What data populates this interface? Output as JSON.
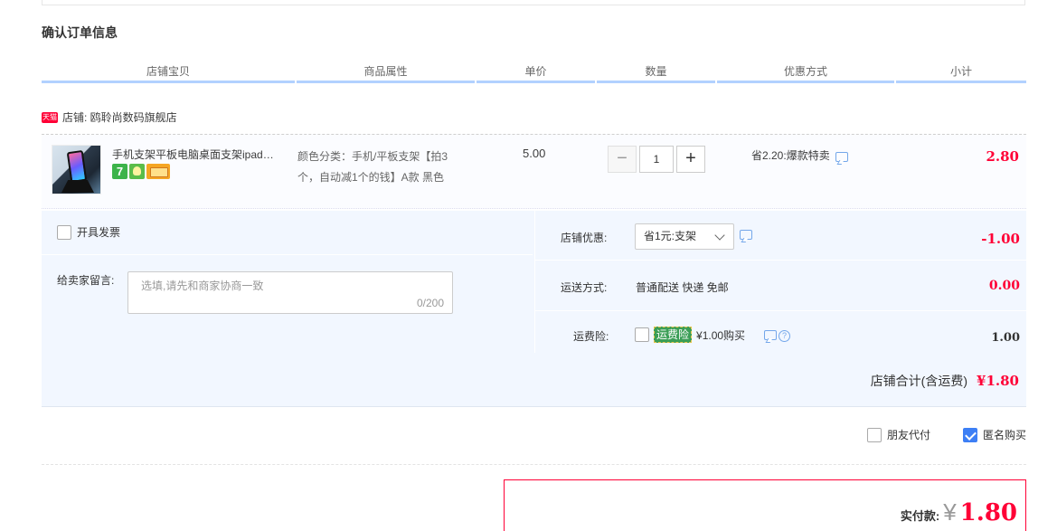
{
  "section_title": "确认订单信息",
  "columns": [
    {
      "key": "item",
      "label": "店铺宝贝"
    },
    {
      "key": "attr",
      "label": "商品属性"
    },
    {
      "key": "price",
      "label": "单价"
    },
    {
      "key": "qty",
      "label": "数量"
    },
    {
      "key": "discount",
      "label": "优惠方式"
    },
    {
      "key": "subtotal",
      "label": "小计"
    }
  ],
  "shop": {
    "badge": "天猫",
    "label": "店铺: 鸥聆尚数码旗舰店"
  },
  "item": {
    "title": "手机支架平板电脑桌面支架ipad…",
    "icon_names": [
      "seven-day-return-icon",
      "consumer-guarantee-icon",
      "credit-card-icon"
    ],
    "icon7_text": "7",
    "attr_line1": "颜色分类：手机/平板支架【拍3",
    "attr_line2": "个，自动减1个的钱】A款 黑色",
    "unit_price": "5.00",
    "qty_minus": "−",
    "qty_value": "1",
    "qty_plus": "+",
    "discount": "省2.20:爆款特卖",
    "subtotal": "2.80"
  },
  "invoice": {
    "label": "开具发票",
    "checked": false
  },
  "remark": {
    "label": "给卖家留言:",
    "placeholder": "选填,请先和商家协商一致",
    "count": "0/200"
  },
  "shop_coupon": {
    "label": "店铺优惠:",
    "selected": "省1元:支架",
    "value": "-1.00"
  },
  "shipping": {
    "label": "运送方式:",
    "method": "普通配送 快递 免邮",
    "value": "0.00"
  },
  "insurance": {
    "label": "运费险:",
    "badge": "运费险",
    "price_text": "¥1.00购买",
    "q_mark": "?",
    "value": "1.00",
    "checked": false
  },
  "shop_total": {
    "label": "店铺合计(含运费)",
    "value": "¥1.80"
  },
  "options": {
    "friend_pay": {
      "label": "朋友代付",
      "checked": false
    },
    "anonymous": {
      "label": "匿名购买",
      "checked": true
    }
  },
  "payment": {
    "label": "实付款:",
    "currency": "¥",
    "amount": "1.80"
  },
  "colors": {
    "accent_red": "#ff0036",
    "header_rule": "#b2d1ff",
    "check_blue": "#3d7ff5"
  }
}
